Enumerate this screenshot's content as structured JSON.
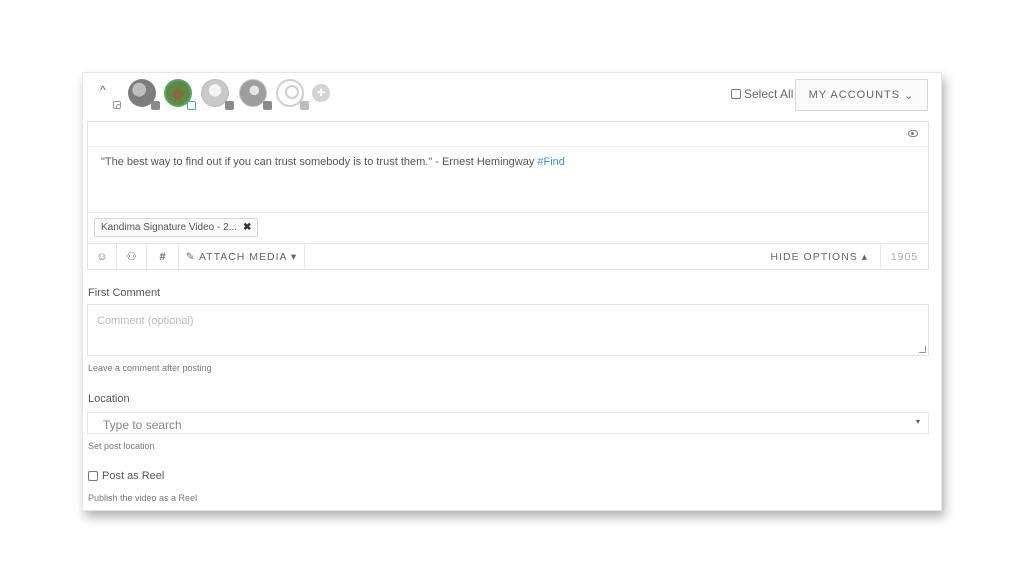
{
  "accounts": {
    "select_all_label": "Select All",
    "my_accounts_label": "MY ACCOUNTS",
    "my_accounts_caret": "⌄",
    "collapse_caret": "^",
    "add_symbol": "+"
  },
  "editor": {
    "post_text": "\"The best way to find out if you can trust somebody is to trust them.\" - Ernest Hemingway ",
    "hashtag": "#Find",
    "hashtag_color": "#3a8fd6",
    "media_chip_label": "Kandima Signature Video - 2...",
    "media_chip_close": "✖",
    "toolbar": {
      "emoji_icon": "☺",
      "ai_icon": "⚇",
      "hash_icon": "#",
      "attach_label": "✎ ATTACH MEDIA ▾",
      "hide_options_label": "HIDE OPTIONS ▴",
      "char_count": "1905"
    }
  },
  "first_comment": {
    "label": "First Comment",
    "placeholder": "Comment (optional)",
    "help": "Leave a comment after posting"
  },
  "location": {
    "label": "Location",
    "placeholder": "Type to search",
    "caret": "▾",
    "help": "Set post location"
  },
  "reel": {
    "label": "Post as Reel",
    "help": "Publish the video as a Reel",
    "checked": false
  }
}
